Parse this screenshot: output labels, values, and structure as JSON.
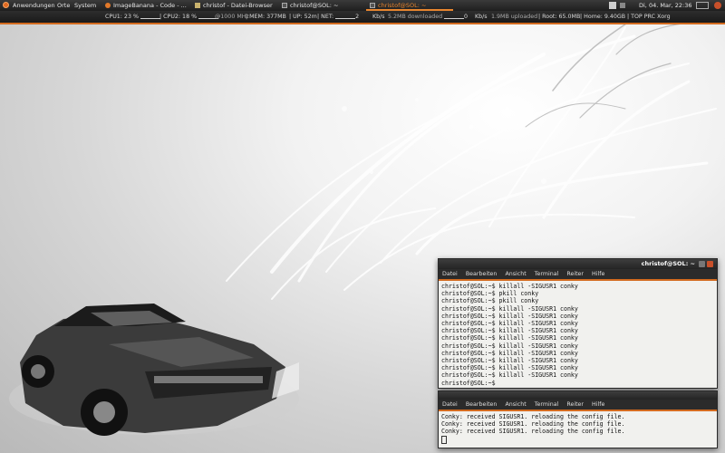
{
  "top_panel": {
    "menus": [
      "Anwendungen",
      "Orte",
      "System"
    ],
    "tasks": [
      {
        "label": "ImageBanana - Code - ...",
        "icon": "firefox-icon"
      },
      {
        "label": "christof - Datei-Browser",
        "icon": "folder-icon"
      },
      {
        "label": "christof@SOL: ~",
        "icon": "terminal-icon"
      },
      {
        "label": "christof@SOL: ~",
        "icon": "terminal-icon",
        "active": true
      }
    ],
    "clock": "Di, 04. Mar, 22:36",
    "colors": {
      "accent": "#e8862f",
      "panel": "#262626"
    }
  },
  "conky": {
    "cpu1": "CPU1: 23 %",
    "cpu2": "CPU2: 18 %",
    "freq": "@1000 MHz",
    "mem": "MEM: 377MB",
    "up": "UP: 52m",
    "net_label": "NET:",
    "net_down_value": "2",
    "net_down_unit": "Kb/s",
    "downloaded": "5.2MB downloaded",
    "net_up_value": "0",
    "net_up_unit": "Kb/s",
    "uploaded": "1.9MB uploaded",
    "root": "Root: 65.0MB",
    "home": "Home: 9.40GB",
    "top": "TOP PRC Xorg"
  },
  "terminal1": {
    "title": "christof@SOL: ~",
    "menu": [
      "Datei",
      "Bearbeiten",
      "Ansicht",
      "Terminal",
      "Reiter",
      "Hilfe"
    ],
    "lines": [
      "christof@SOL:~$ killall -SIGUSR1 conky",
      "christof@SOL:~$ pkill conky",
      "christof@SOL:~$ pkill conky",
      "christof@SOL:~$ killall -SIGUSR1 conky",
      "christof@SOL:~$ killall -SIGUSR1 conky",
      "christof@SOL:~$ killall -SIGUSR1 conky",
      "christof@SOL:~$ killall -SIGUSR1 conky",
      "christof@SOL:~$ killall -SIGUSR1 conky",
      "christof@SOL:~$ killall -SIGUSR1 conky",
      "christof@SOL:~$ killall -SIGUSR1 conky",
      "christof@SOL:~$ killall -SIGUSR1 conky",
      "christof@SOL:~$ killall -SIGUSR1 conky",
      "christof@SOL:~$ killall -SIGUSR1 conky",
      "christof@SOL:~$"
    ]
  },
  "terminal2": {
    "menu": [
      "Datei",
      "Bearbeiten",
      "Ansicht",
      "Terminal",
      "Reiter",
      "Hilfe"
    ],
    "lines": [
      "Conky: received SIGUSR1. reloading the config file.",
      "Conky: received SIGUSR1. reloading the config file.",
      "Conky: received SIGUSR1. reloading the config file."
    ]
  }
}
